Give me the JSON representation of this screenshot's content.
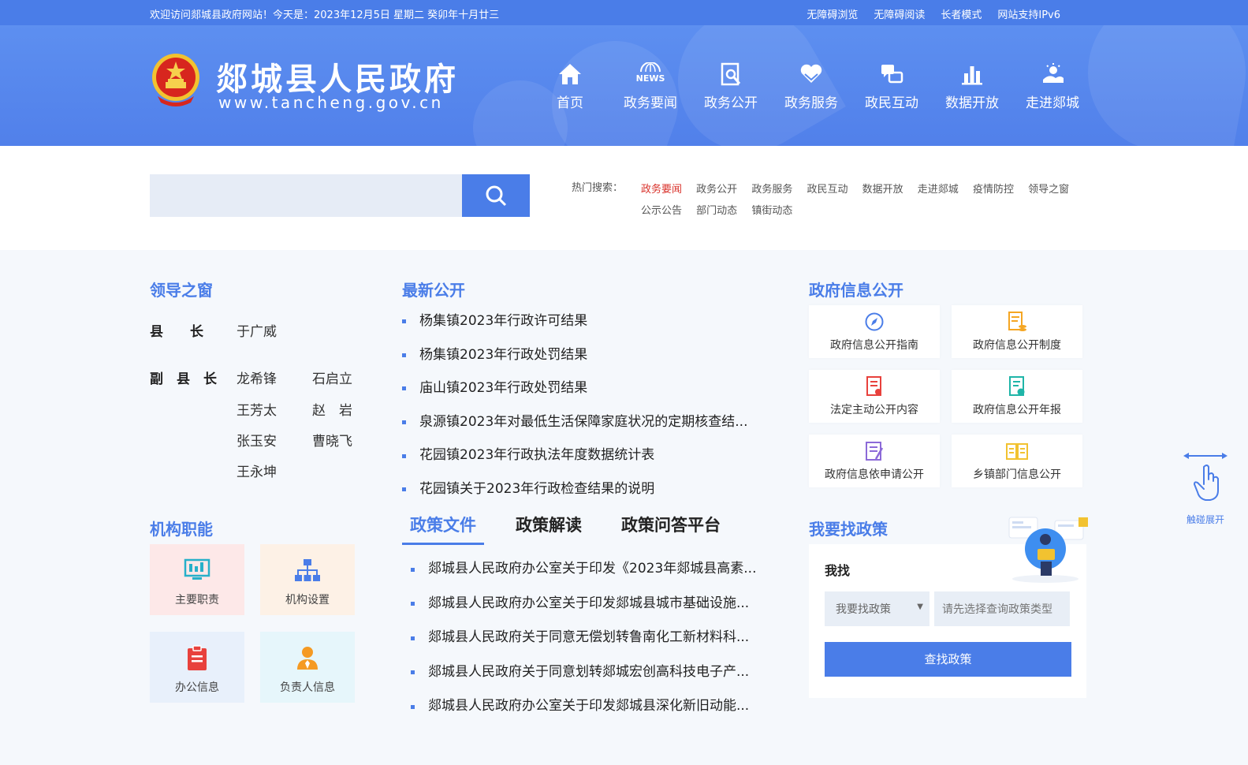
{
  "topbar": {
    "welcome": "欢迎访问郯城县政府网站！今天是：2023年12月5日  星期二  癸卯年十月廿三",
    "links": [
      "无障碍浏览",
      "无障碍阅读",
      "长者模式",
      "网站支持IPv6"
    ]
  },
  "header": {
    "title": "郯城县人民政府",
    "url": "www.tancheng.gov.cn",
    "nav": [
      {
        "label": "首页",
        "icon": "home-icon"
      },
      {
        "label": "政务要闻",
        "icon": "news-icon",
        "icon_text": "NEWS"
      },
      {
        "label": "政务公开",
        "icon": "document-search-icon"
      },
      {
        "label": "政务服务",
        "icon": "heart-hands-icon"
      },
      {
        "label": "政民互动",
        "icon": "chat-icon"
      },
      {
        "label": "数据开放",
        "icon": "bar-chart-icon"
      },
      {
        "label": "走进郯城",
        "icon": "scenery-icon"
      }
    ]
  },
  "search": {
    "placeholder": "",
    "hot_label": "热门搜索：",
    "hot_terms": [
      "政务要闻",
      "政务公开",
      "政务服务",
      "政民互动",
      "数据开放",
      "走进郯城",
      "疫情防控",
      "领导之窗",
      "公示公告",
      "部门动态",
      "镇街动态"
    ]
  },
  "leaders": {
    "title": "领导之窗",
    "county_head_role": "县　　长",
    "county_head": "于广威",
    "deputy_role": "副　县　长",
    "deputies": [
      "龙希锋",
      "石启立",
      "王芳太",
      "赵　岩",
      "张玉安",
      "曹晓飞",
      "王永坤"
    ]
  },
  "org": {
    "title": "机构职能",
    "cards": [
      {
        "label": "主要职责",
        "icon": "monitor-icon",
        "bg": "#fde8e8"
      },
      {
        "label": "机构设置",
        "icon": "org-chart-icon",
        "bg": "#fdf1e6"
      },
      {
        "label": "办公信息",
        "icon": "clipboard-icon",
        "bg": "#e8f0fb"
      },
      {
        "label": "负责人信息",
        "icon": "person-icon",
        "bg": "#e6f6fb"
      }
    ]
  },
  "latest": {
    "title": "最新公开",
    "items": [
      "杨集镇2023年行政许可结果",
      "杨集镇2023年行政处罚结果",
      "庙山镇2023年行政处罚结果",
      "泉源镇2023年对最低生活保障家庭状况的定期核查结...",
      "花园镇2023年行政执法年度数据统计表",
      "花园镇关于2023年行政检查结果的说明"
    ]
  },
  "policy": {
    "tabs": [
      "政策文件",
      "政策解读",
      "政策问答平台"
    ],
    "items": [
      "郯城县人民政府办公室关于印发《2023年郯城县高素...",
      "郯城县人民政府办公室关于印发郯城县城市基础设施...",
      "郯城县人民政府关于同意无偿划转鲁南化工新材料科...",
      "郯城县人民政府关于同意划转郯城宏创高科技电子产...",
      "郯城县人民政府办公室关于印发郯城县深化新旧动能..."
    ]
  },
  "gov_info": {
    "title": "政府信息公开",
    "cards": [
      {
        "label": "政府信息公开指南",
        "icon": "compass-icon"
      },
      {
        "label": "政府信息公开制度",
        "icon": "document-stack-icon"
      },
      {
        "label": "法定主动公开内容",
        "icon": "report-icon"
      },
      {
        "label": "政府信息公开年报",
        "icon": "annual-report-icon"
      },
      {
        "label": "政府信息依申请公开",
        "icon": "application-form-icon"
      },
      {
        "label": "乡镇部门信息公开",
        "icon": "open-book-icon"
      }
    ]
  },
  "find_policy": {
    "title": "我要找政策",
    "label": "我找",
    "select_value": "我要找政策",
    "type_placeholder": "请先选择查询政策类型",
    "button": "查找政策"
  },
  "side": {
    "expand_label": "触碰展开"
  }
}
